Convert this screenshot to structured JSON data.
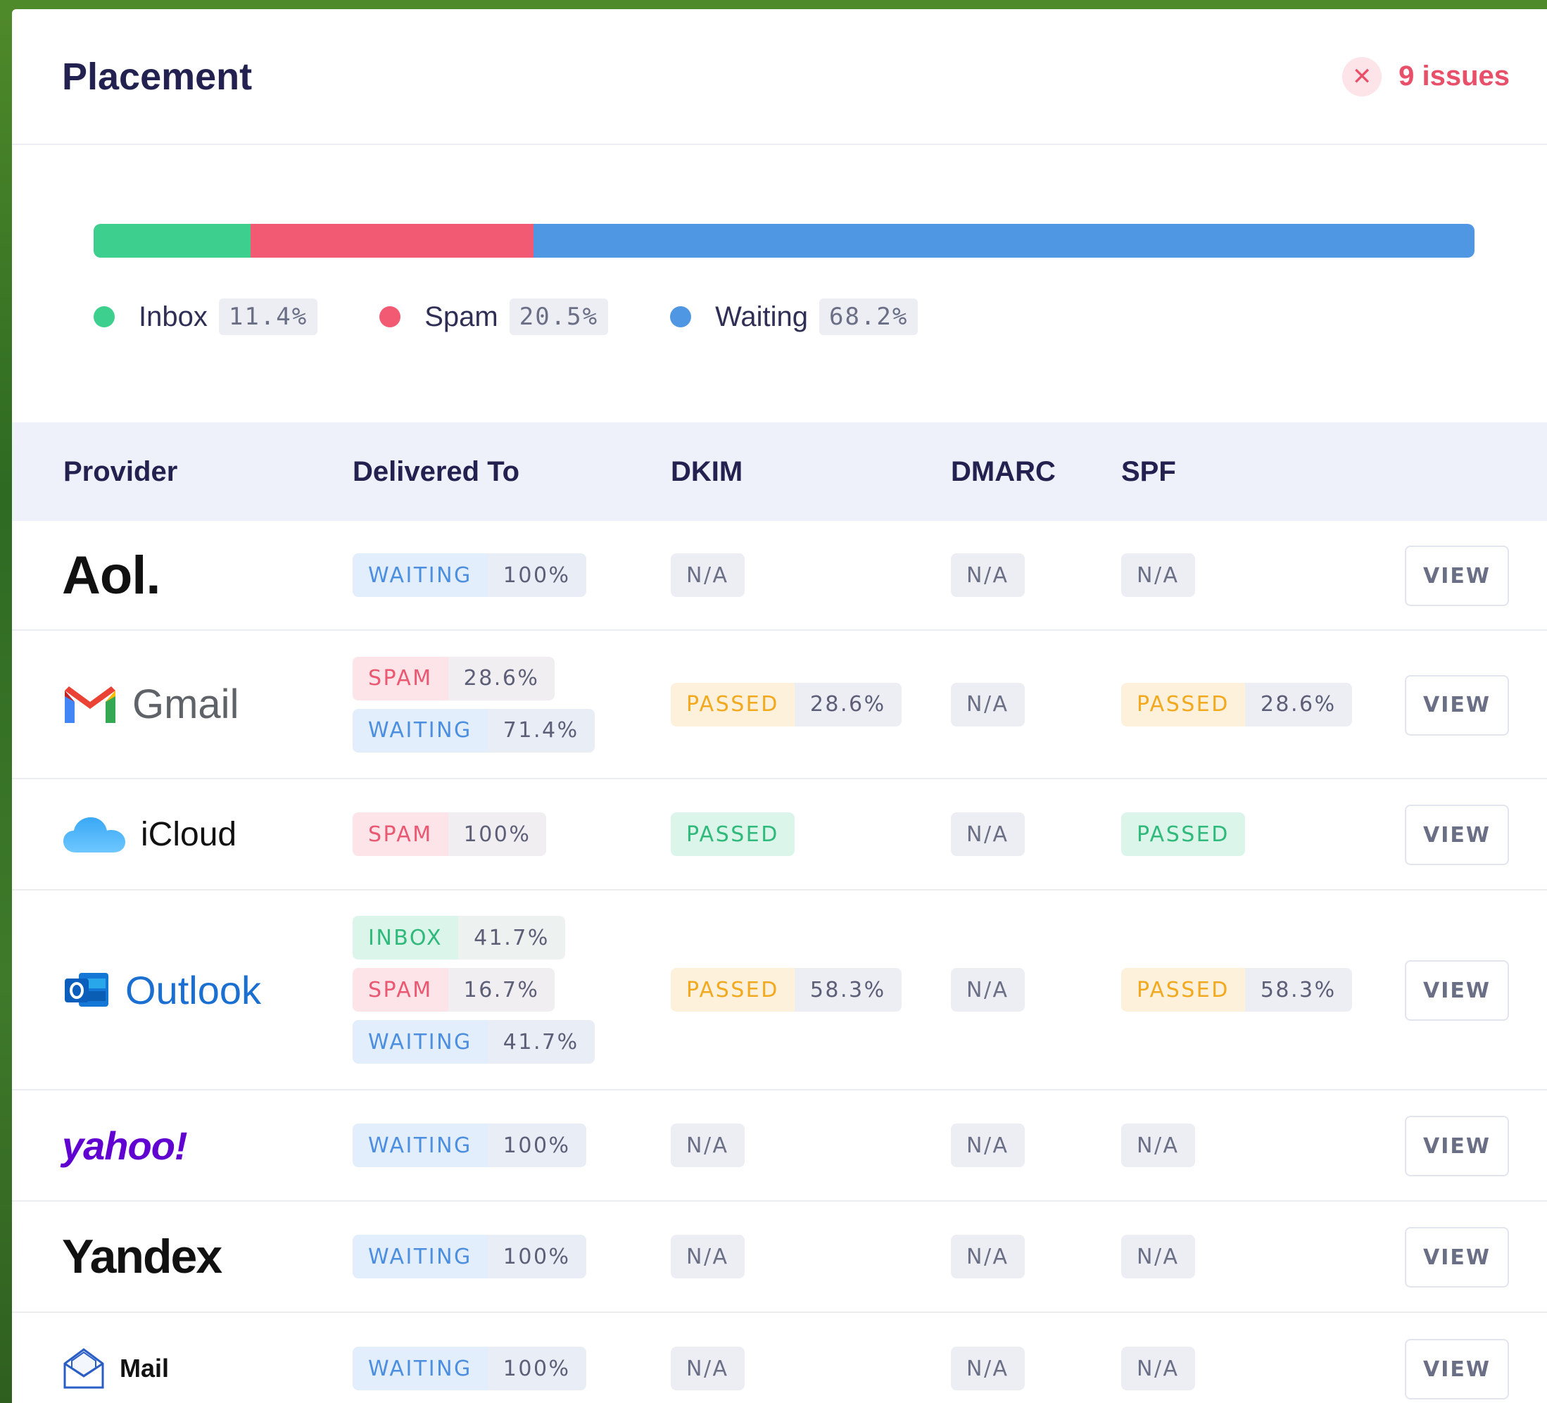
{
  "header": {
    "title": "Placement",
    "issues_label": "9 issues"
  },
  "colors": {
    "inbox": "#3ccf8e",
    "spam": "#f25a74",
    "waiting": "#4f96e3"
  },
  "placement": {
    "bar": [
      {
        "name": "inbox",
        "fraction": 0.114
      },
      {
        "name": "spam",
        "fraction": 0.205
      },
      {
        "name": "waiting",
        "fraction": 0.682
      }
    ],
    "legend": [
      {
        "label": "Inbox",
        "pct": "11.4%"
      },
      {
        "label": "Spam",
        "pct": "20.5%"
      },
      {
        "label": "Waiting",
        "pct": "68.2%"
      }
    ]
  },
  "table": {
    "columns": [
      "Provider",
      "Delivered To",
      "DKIM",
      "DMARC",
      "SPF"
    ],
    "view_label": "VIEW",
    "rows": [
      {
        "provider": "Aol.",
        "logo_icon": "aol-logo",
        "delivered": [
          {
            "status": "WAITING",
            "pct": "100%"
          }
        ],
        "dkim": {
          "status": "N/A"
        },
        "dmarc": {
          "status": "N/A"
        },
        "spf": {
          "status": "N/A"
        }
      },
      {
        "provider": "Gmail",
        "logo_icon": "gmail-logo",
        "delivered": [
          {
            "status": "SPAM",
            "pct": "28.6%"
          },
          {
            "status": "WAITING",
            "pct": "71.4%"
          }
        ],
        "dkim": {
          "status": "PASSED",
          "pct": "28.6%"
        },
        "dmarc": {
          "status": "N/A"
        },
        "spf": {
          "status": "PASSED",
          "pct": "28.6%"
        }
      },
      {
        "provider": "iCloud",
        "logo_icon": "icloud-logo",
        "delivered": [
          {
            "status": "SPAM",
            "pct": "100%"
          }
        ],
        "dkim": {
          "status": "PASSED"
        },
        "dmarc": {
          "status": "N/A"
        },
        "spf": {
          "status": "PASSED"
        }
      },
      {
        "provider": "Outlook",
        "logo_icon": "outlook-logo",
        "delivered": [
          {
            "status": "INBOX",
            "pct": "41.7%"
          },
          {
            "status": "SPAM",
            "pct": "16.7%"
          },
          {
            "status": "WAITING",
            "pct": "41.7%"
          }
        ],
        "dkim": {
          "status": "PASSED",
          "pct": "58.3%"
        },
        "dmarc": {
          "status": "N/A"
        },
        "spf": {
          "status": "PASSED",
          "pct": "58.3%"
        }
      },
      {
        "provider": "yahoo!",
        "logo_icon": "yahoo-logo",
        "delivered": [
          {
            "status": "WAITING",
            "pct": "100%"
          }
        ],
        "dkim": {
          "status": "N/A"
        },
        "dmarc": {
          "status": "N/A"
        },
        "spf": {
          "status": "N/A"
        }
      },
      {
        "provider": "Yandex",
        "logo_icon": "yandex-logo",
        "delivered": [
          {
            "status": "WAITING",
            "pct": "100%"
          }
        ],
        "dkim": {
          "status": "N/A"
        },
        "dmarc": {
          "status": "N/A"
        },
        "spf": {
          "status": "N/A"
        }
      },
      {
        "provider": "Mail",
        "logo_icon": "mail-logo",
        "delivered": [
          {
            "status": "WAITING",
            "pct": "100%"
          }
        ],
        "dkim": {
          "status": "N/A"
        },
        "dmarc": {
          "status": "N/A"
        },
        "spf": {
          "status": "N/A"
        }
      }
    ]
  }
}
